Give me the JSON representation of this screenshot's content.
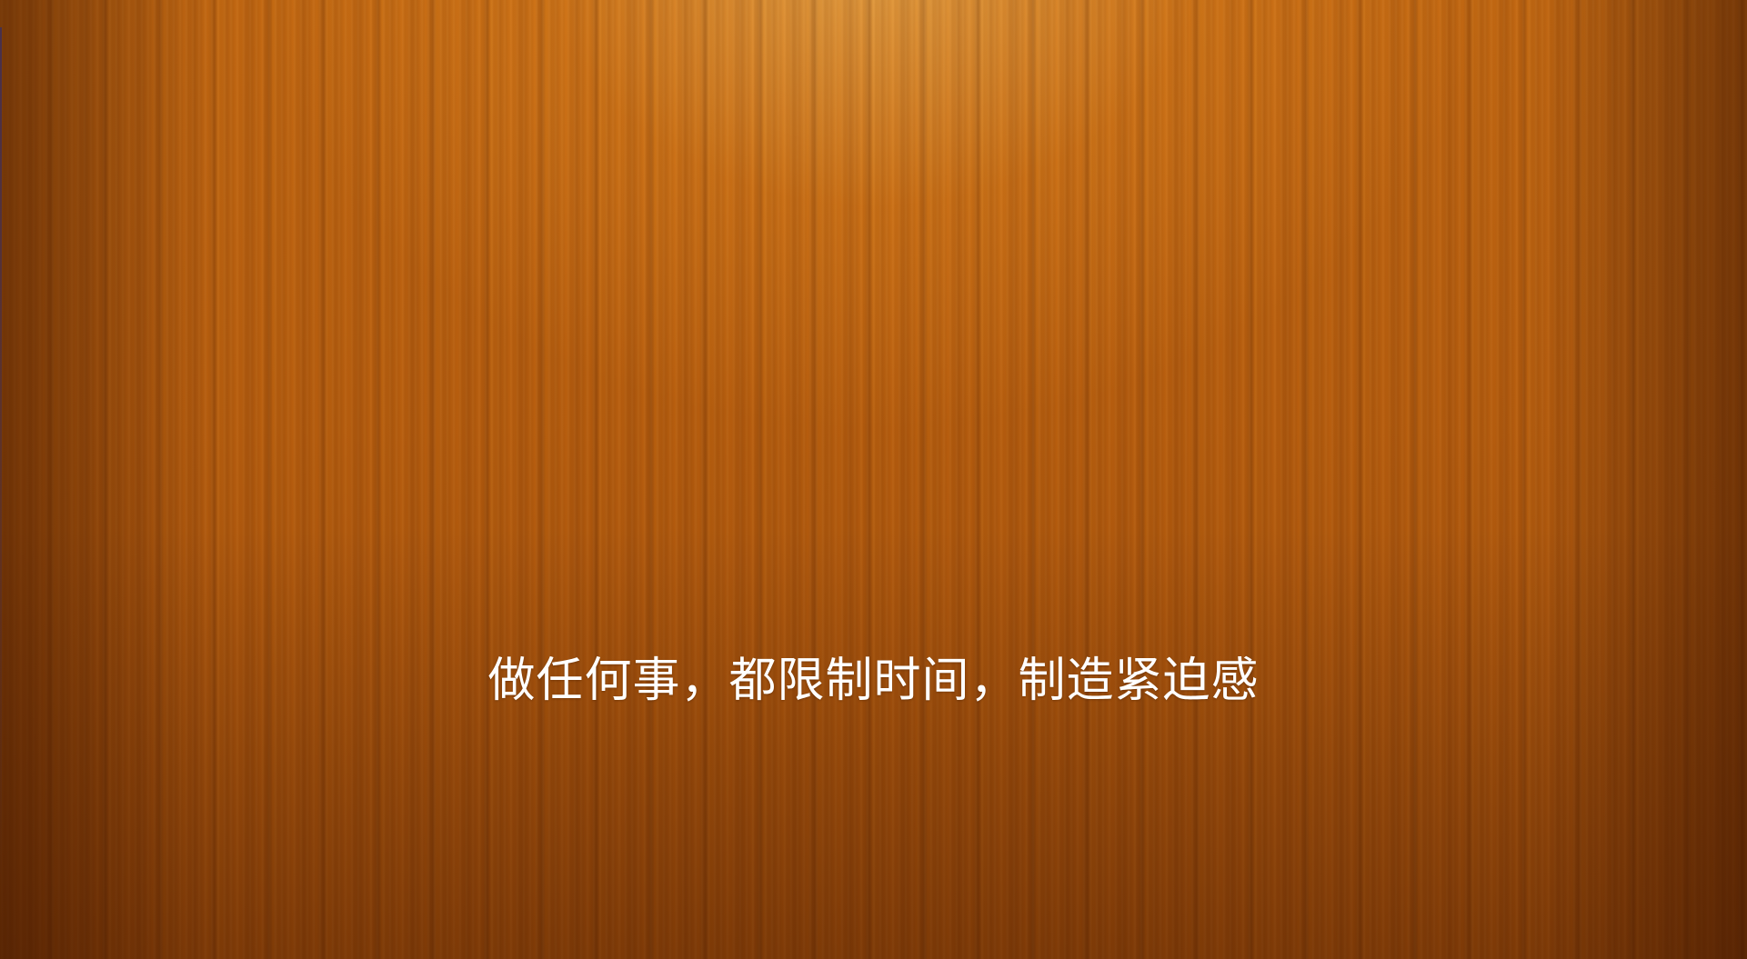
{
  "slide": {
    "caption": "做任何事，都限制时间，制造紧迫感"
  },
  "colors": {
    "background": "#c46a12",
    "text": "#ffffff"
  }
}
